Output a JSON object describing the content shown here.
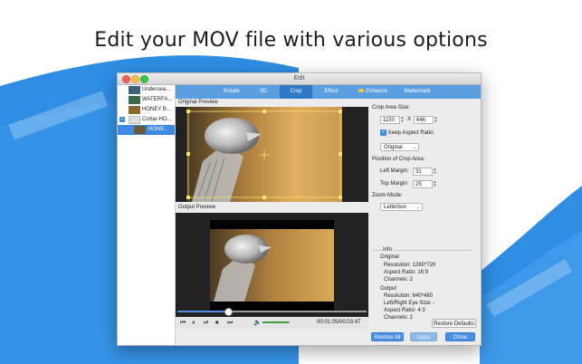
{
  "headline": "Edit your MOV file with various options",
  "window": {
    "title": "Edit"
  },
  "sidebar": {
    "items": [
      {
        "label": "Undersea...",
        "selected": false,
        "checkbox": false
      },
      {
        "label": "WATERFA...",
        "selected": false,
        "checkbox": false
      },
      {
        "label": "HONEY B...",
        "selected": false,
        "checkbox": false
      },
      {
        "label": "Cortar-HO...",
        "selected": false,
        "checkbox": true
      },
      {
        "label": "HONE...",
        "selected": true,
        "checkbox": false
      }
    ]
  },
  "tabs": [
    {
      "label": "Rotate",
      "active": false
    },
    {
      "label": "3D",
      "active": false
    },
    {
      "label": "Crop",
      "active": true
    },
    {
      "label": "Effect",
      "active": false
    },
    {
      "label": "Enhance",
      "active": false
    },
    {
      "label": "Watermark",
      "active": false
    }
  ],
  "preview": {
    "original_label": "Original Preview",
    "output_label": "Output Preview",
    "time": "00:01:05/00:03:47",
    "seek_progress": 0.27,
    "volume_level": 0.95
  },
  "crop": {
    "area_size_label": "Crop Area Size:",
    "width": "1150",
    "height": "646",
    "times": "X",
    "keep_aspect_label": "Keep Aspect Ratio:",
    "keep_aspect_checked": true,
    "aspect_value": "Original",
    "position_label": "Position of Crop Area:",
    "left_margin_label": "Left Margin:",
    "left_margin": "31",
    "top_margin_label": "Top Margin:",
    "top_margin": "25",
    "zoom_label": "Zoom Mode:",
    "zoom_value": "Letterbox"
  },
  "info": {
    "title": "Info",
    "original_label": "Original",
    "orig_resolution": "Resolution: 1280*720",
    "orig_aspect": "Aspect Ratio: 16:9",
    "orig_channels": "Channels: 2",
    "output_label": "Output",
    "out_resolution": "Resolution: 640*480",
    "out_eye": "Left/Right Eye Size: -",
    "out_aspect": "Aspect Ratio: 4:3",
    "out_channels": "Channels: 2"
  },
  "buttons": {
    "restore_defaults": "Restore Defaults",
    "restore_all": "Restore All",
    "apply": "Apply",
    "close": "Close"
  },
  "colors": {
    "accent": "#4a90e2",
    "tabbar": "#5b9fe0",
    "background_blue": "#2f8de4"
  }
}
